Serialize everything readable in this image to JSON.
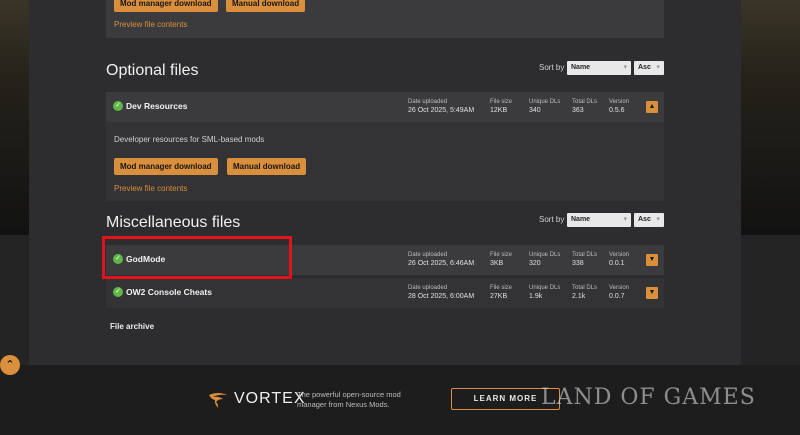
{
  "top_card": {
    "mod_manager_label": "Mod manager download",
    "manual_label": "Manual download",
    "preview_label": "Preview file contents"
  },
  "optional": {
    "title": "Optional files",
    "sort_label": "Sort by",
    "sort_value": "Name",
    "order_value": "Asc",
    "files": [
      {
        "name": "Dev Resources",
        "date_label": "Date uploaded",
        "date": "26 Oct 2025, 5:49AM",
        "size_label": "File size",
        "size": "12KB",
        "unique_label": "Unique DLs",
        "unique": "340",
        "total_label": "Total DLs",
        "total": "363",
        "version_label": "Version",
        "version": "0.5.6",
        "description": "Developer resources for SML-based mods",
        "mod_manager_label": "Mod manager download",
        "manual_label": "Manual download",
        "preview_label": "Preview file contents"
      }
    ]
  },
  "misc": {
    "title": "Miscellaneous files",
    "sort_label": "Sort by",
    "sort_value": "Name",
    "order_value": "Asc",
    "files": [
      {
        "name": "GodMode",
        "date_label": "Date uploaded",
        "date": "26 Oct 2025, 6:46AM",
        "size_label": "File size",
        "size": "3KB",
        "unique_label": "Unique DLs",
        "unique": "320",
        "total_label": "Total DLs",
        "total": "338",
        "version_label": "Version",
        "version": "0.0.1"
      },
      {
        "name": "OW2 Console Cheats",
        "date_label": "Date uploaded",
        "date": "28 Oct 2025, 6:00AM",
        "size_label": "File size",
        "size": "27KB",
        "unique_label": "Unique DLs",
        "unique": "1.9k",
        "total_label": "Total DLs",
        "total": "2.1k",
        "version_label": "Version",
        "version": "0.0.7"
      }
    ],
    "archive_label": "File archive"
  },
  "footer": {
    "brand": "VORTEX",
    "tagline": "The powerful open-source mod manager from Nexus Mods.",
    "cta": "LEARN MORE",
    "watermark": "LAND OF GAMES"
  },
  "icons": {
    "check": "check-circle-icon",
    "chevron_up": "chevron-up-icon",
    "chevron_down": "chevron-down-icon",
    "vortex": "vortex-logo-icon",
    "scroll_top": "scroll-to-top-icon"
  },
  "colors": {
    "accent": "#d98f3c",
    "success": "#5fb846",
    "highlight": "#e0141a"
  }
}
